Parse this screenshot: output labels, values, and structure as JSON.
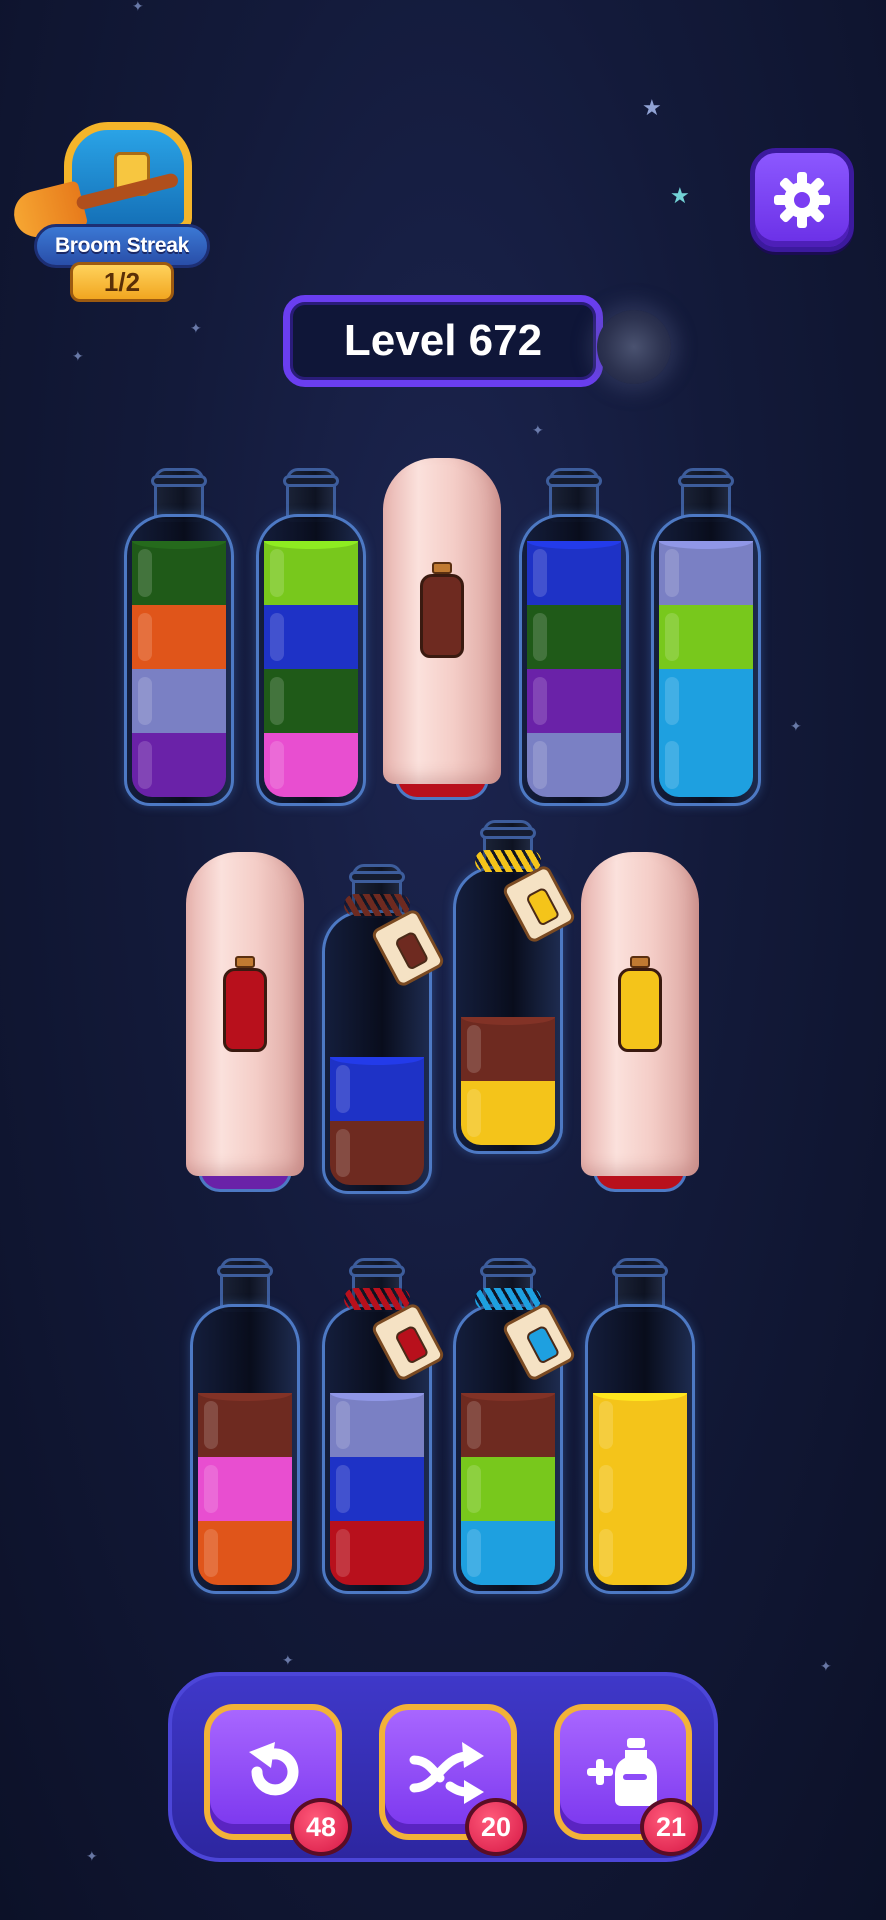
{
  "header": {
    "broom_streak": {
      "label": "Broom Streak",
      "progress": "1/2"
    },
    "level_label": "Level 672"
  },
  "colors": {
    "dark_green": "#1f5a18",
    "orange": "#e0551a",
    "lavender": "#7a80c4",
    "purple": "#6a22a8",
    "lime": "#78c81c",
    "blue": "#1e32c6",
    "pink": "#e84ed0",
    "sky": "#1ea0e0",
    "brown": "#6e2a20",
    "yellow": "#f4c41a",
    "red": "#b8101c"
  },
  "bottles": {
    "row1": [
      {
        "id": "b1",
        "layers": [
          "purple",
          "lavender",
          "orange",
          "dark_green"
        ]
      },
      {
        "id": "b2",
        "layers": [
          "pink",
          "dark_green",
          "blue",
          "lime"
        ]
      },
      {
        "id": "b3",
        "covered": true,
        "hint_color": "brown",
        "base_color": "red"
      },
      {
        "id": "b4",
        "layers": [
          "lavender",
          "purple",
          "dark_green",
          "blue"
        ]
      },
      {
        "id": "b5",
        "layers": [
          "sky",
          "sky",
          "lime",
          "lavender"
        ]
      }
    ],
    "row2": [
      {
        "id": "b6",
        "covered": true,
        "hint_color": "red",
        "base_color": "purple"
      },
      {
        "id": "b7",
        "layers": [
          "brown",
          "blue"
        ],
        "rope": "brown",
        "tag_color": "brown"
      },
      {
        "id": "b8",
        "layers": [
          "yellow",
          "brown"
        ],
        "rope": "yellow",
        "tag_color": "yellow"
      },
      {
        "id": "b9",
        "covered": true,
        "hint_color": "yellow",
        "base_color": "red"
      }
    ],
    "row3": [
      {
        "id": "b10",
        "layers": [
          "orange",
          "pink",
          "brown"
        ]
      },
      {
        "id": "b11",
        "layers": [
          "red",
          "blue",
          "lavender"
        ],
        "rope": "red",
        "tag_color": "red"
      },
      {
        "id": "b12",
        "layers": [
          "sky",
          "lime",
          "brown"
        ],
        "rope": "sky",
        "tag_color": "sky"
      },
      {
        "id": "b13",
        "layers": [
          "yellow",
          "yellow",
          "yellow"
        ]
      }
    ]
  },
  "toolbar": {
    "undo": {
      "icon": "undo-icon",
      "count": "48"
    },
    "shuffle": {
      "icon": "shuffle-icon",
      "count": "20"
    },
    "add_bottle": {
      "icon": "add-bottle-icon",
      "count": "21"
    }
  }
}
